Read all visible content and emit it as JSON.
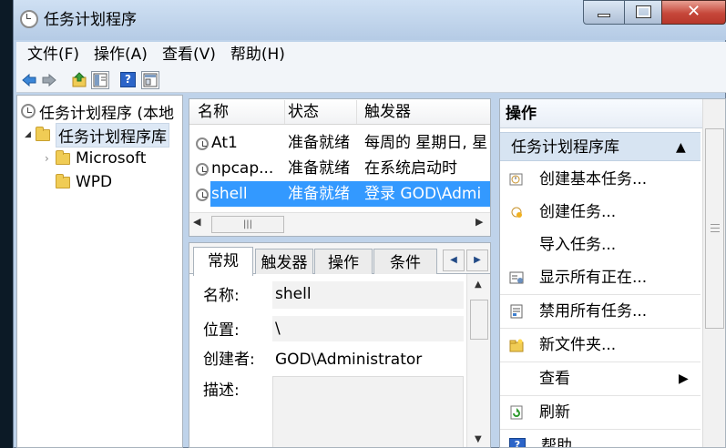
{
  "window": {
    "title": "任务计划程序",
    "controls": {
      "minimize": "minimize",
      "maximize": "maximize",
      "close": "close"
    }
  },
  "menu": [
    {
      "label": "文件(F)"
    },
    {
      "label": "操作(A)"
    },
    {
      "label": "查看(V)"
    },
    {
      "label": "帮助(H)"
    }
  ],
  "toolbar": [
    "back-arrow-icon",
    "forward-arrow-icon",
    "up-folder-icon",
    "show-hide-tree-icon",
    "help-icon",
    "properties-icon"
  ],
  "tree": {
    "root": "任务计划程序 (本地",
    "library": "任务计划程序库",
    "children": [
      {
        "label": "Microsoft"
      },
      {
        "label": "WPD"
      }
    ]
  },
  "task_list": {
    "columns": {
      "name": "名称",
      "status": "状态",
      "trigger": "触发器"
    },
    "rows": [
      {
        "name": "At1",
        "status": "准备就绪",
        "trigger": "每周的 星期日, 星"
      },
      {
        "name": "npcap...",
        "status": "准备就绪",
        "trigger": "在系统启动时"
      },
      {
        "name": "shell",
        "status": "准备就绪",
        "trigger": "登录 GOD\\Admi"
      }
    ],
    "scroll_thumb_glyph": "|||"
  },
  "details": {
    "tabs": [
      {
        "label": "常规"
      },
      {
        "label": "触发器"
      },
      {
        "label": "操作"
      },
      {
        "label": "条件"
      }
    ],
    "fields": {
      "name_label": "名称:",
      "name_value": "shell",
      "location_label": "位置:",
      "location_value": "\\",
      "author_label": "创建者:",
      "author_value": "GOD\\Administrator",
      "desc_label": "描述:"
    }
  },
  "actions": {
    "header": "操作",
    "section": "任务计划程序库",
    "items": [
      {
        "label": "创建基本任务...",
        "icon": "create-basic-task-icon"
      },
      {
        "label": "创建任务...",
        "icon": "create-task-icon"
      },
      {
        "label": "导入任务...",
        "icon": ""
      },
      {
        "label": "显示所有正在...",
        "icon": "display-running-icon"
      },
      {
        "label": "禁用所有任务...",
        "icon": "disable-history-icon"
      },
      {
        "label": "新文件夹...",
        "icon": "new-folder-icon"
      },
      {
        "label": "查看",
        "icon": ""
      },
      {
        "label": "刷新",
        "icon": "refresh-icon"
      },
      {
        "label": "帮助",
        "icon": "help-icon"
      }
    ]
  },
  "colors": {
    "titlebar": "#bfd3ea",
    "close_button": "#c6473a",
    "selection": "#3399ff",
    "actions_section": "#d7e4f2"
  }
}
